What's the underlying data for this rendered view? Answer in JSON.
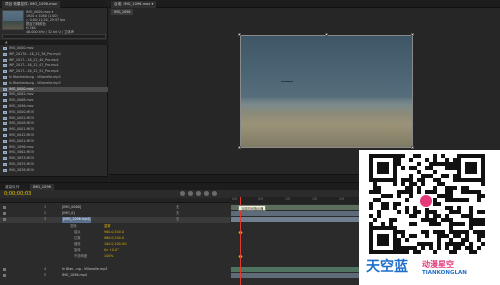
{
  "project": {
    "tabs": [
      "项目 效果控件: IMG_1096.mov"
    ],
    "media_name": "IMG_0000.mov ▾",
    "media_lines": [
      "1920 x 1080 (1.00)",
      "△ 0;00;11;26, 29.97 fps",
      "数百万种颜色",
      "H.264",
      "48.000 kHz / 32 bit U / 立体声"
    ],
    "files": [
      "IMG_0000.mov",
      "WP_20170...16_22_36_Pro.mp4",
      "WP_2017...16_22_40_Pro.mp4",
      "WP_2017...16_22_47_Pro.mp4",
      "WP_2017...16_22_51_Pro.mp4",
      "In Blankenburg - Villanelle.mp3",
      "In Blankenburg - Villanelle.mp3",
      "IMG_0000.mov",
      "IMG_0062.mov",
      "IMG_0068.mov",
      "IMG_1096.mov",
      "IMG_0000.MOV",
      "IMG_0002.MOV",
      "IMG_0008.MOV",
      "IMG_0001.MOV",
      "IMG_0042.MOV",
      "IMG_0001.MOV",
      "IMG_1096.mov",
      "IMG_5862.MOV",
      "IMG_5833.MOV",
      "IMG_5835.MOV",
      "IMG_5838.MOV"
    ],
    "selected_index": 7
  },
  "viewer": {
    "tab_label": "合成: IMG_1096.mov ▾",
    "sub_tab": "IMG_1096"
  },
  "timeline": {
    "tabs": [
      "渲染队列",
      "IMG_1096"
    ],
    "timecode": "0;00;00;03",
    "ruler_ticks": [
      "00f",
      "05f",
      "10f",
      "15f",
      "20f",
      "25f",
      "01:00f",
      "05f",
      "10f",
      "15f"
    ],
    "tooltip": "当前时间指示器",
    "layers": [
      {
        "num": "1",
        "name": "[IMG_0068]",
        "parent": "无"
      },
      {
        "num": "2",
        "name": "[IMG_0]",
        "parent": "无"
      },
      {
        "num": "3",
        "name": "[IMG_1096.mp4]",
        "parent": "无"
      }
    ],
    "properties": [
      {
        "name": "变换",
        "value": "重置"
      },
      {
        "name": "锚点",
        "value": "960.0,540.0"
      },
      {
        "name": "位置",
        "value": "960.0,540.0"
      },
      {
        "name": "缩放",
        "value": "100.0,100.0%"
      },
      {
        "name": "旋转",
        "value": "0x +0.0°"
      },
      {
        "name": "不透明度",
        "value": "100%"
      }
    ],
    "audio_rows": [
      {
        "num": "4",
        "name": "In Blan...ng - Villanelle.mp3"
      },
      {
        "num": "5",
        "name": "IMG_1096.mp4"
      }
    ]
  },
  "overlay": {
    "brand": "天空蓝",
    "brand_sub": "动漫星空",
    "brand_domain": "TIANKONGLAN"
  }
}
